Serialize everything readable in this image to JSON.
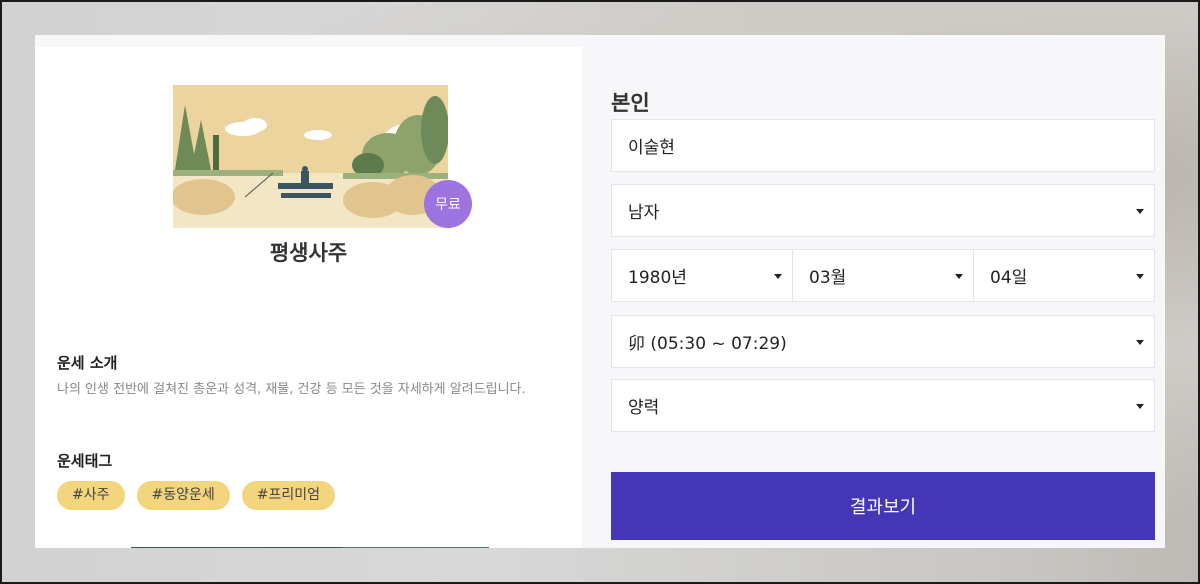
{
  "product": {
    "badge": "무료",
    "title": "평생사주",
    "intro_title": "운세 소개",
    "intro_text": "나의 인생 전반에 걸쳐진 총운과 성격, 재물, 건강 등 모든 것을 자세하게 알려드립니다.",
    "tags_title": "운세태그",
    "tags": [
      "#사주",
      "#동양운세",
      "#프리미엄"
    ]
  },
  "form": {
    "label": "본인",
    "name_value": "이술현",
    "gender_value": "남자",
    "year_value": "1980년",
    "month_value": "03월",
    "day_value": "04일",
    "time_value": "卯 (05:30 ~ 07:29)",
    "calendar_value": "양력",
    "submit_label": "결과보기"
  },
  "colors": {
    "accent": "#4536b6",
    "badge": "#9d73df",
    "tag": "#f2d57c"
  },
  "icons": {
    "dropdown": "caret-down-icon",
    "thumbnail": "landscape-illustration"
  }
}
